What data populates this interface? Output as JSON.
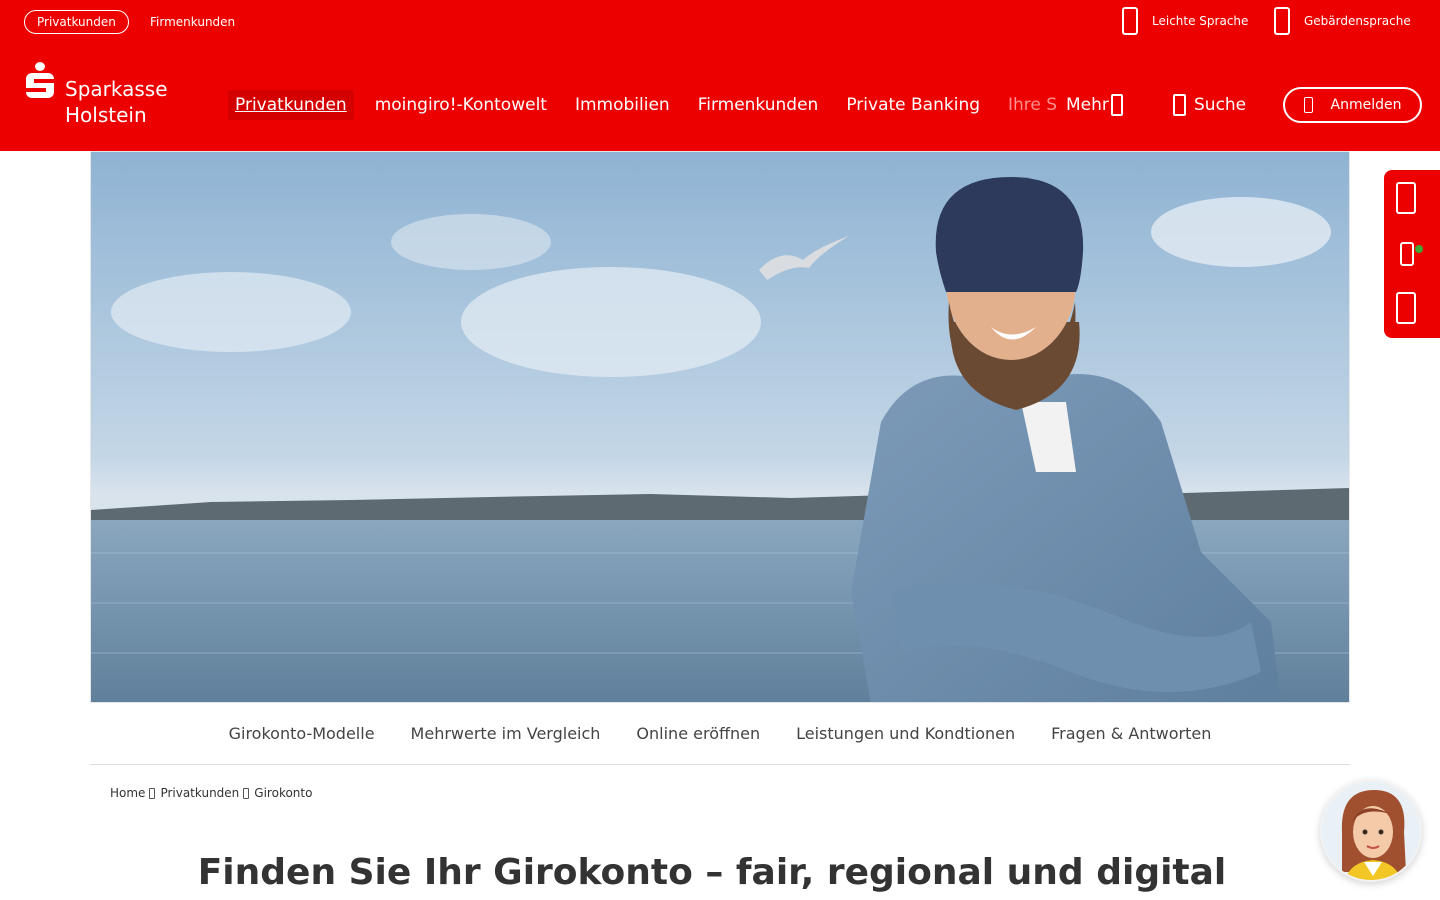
{
  "segment": {
    "active": "Privatkunden",
    "other": "Firmenkunden"
  },
  "accessibility": {
    "easy_language": "Leichte Sprache",
    "sign_language": "Gebärdensprache"
  },
  "brand": {
    "line1": "Sparkasse",
    "line2": "Holstein",
    "color": "#ec0000"
  },
  "nav": {
    "items": [
      "Privatkunden",
      "moingiro!-Kontowelt",
      "Immobilien",
      "Firmenkunden",
      "Private Banking",
      "Ihre S"
    ],
    "more": "Mehr",
    "search": "Suche",
    "login": "Anmelden"
  },
  "hero": {
    "image": "man-with-beanie-at-sea-photo"
  },
  "sidebar": {
    "icons": [
      "phone-icon",
      "chat-icon",
      "mail-icon"
    ],
    "status_color": "#3aa935"
  },
  "subnav": [
    "Girokonto-Modelle",
    "Mehrwerte im Vergleich",
    "Online eröffnen",
    "Leistungen und Kondtionen",
    "Fragen & Antworten"
  ],
  "breadcrumb": [
    "Home",
    "Privatkunden",
    "Girokonto"
  ],
  "headline": "Finden Sie Ihr Girokonto – fair, regional und digital",
  "assistant": {
    "icon": "virtual-assistant-avatar"
  }
}
